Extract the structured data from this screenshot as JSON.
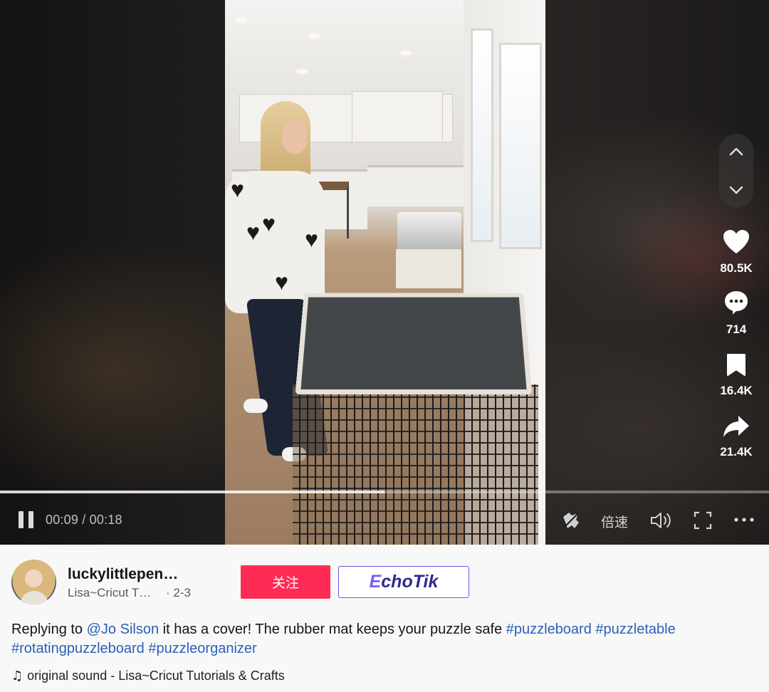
{
  "player": {
    "time_current": "00:09",
    "time_total": "00:18",
    "progress": 0.5,
    "speed_label": "倍速"
  },
  "actions": {
    "likes": "80.5K",
    "comments": "714",
    "saves": "16.4K",
    "shares": "21.4K"
  },
  "author": {
    "username": "luckylittlepen…",
    "nickname": "Lisa~Cricut T…",
    "date": "· 2-3"
  },
  "buttons": {
    "follow": "关注",
    "echotik_prefix": "E",
    "echotik_rest": "choTik"
  },
  "description": {
    "prefix": "Replying to ",
    "mention": "@Jo Silson",
    "text": " it has a cover! The rubber mat keeps your puzzle safe ",
    "hashtags": [
      "#puzzleboard",
      "#puzzletable",
      "#rotatingpuzzleboard",
      "#puzzleorganizer"
    ]
  },
  "sound": "original sound - Lisa~Cricut Tutorials & Crafts",
  "colors": {
    "follow": "#fe2c55",
    "link": "#2b5fb8",
    "echotik_border": "#6b56e6"
  }
}
